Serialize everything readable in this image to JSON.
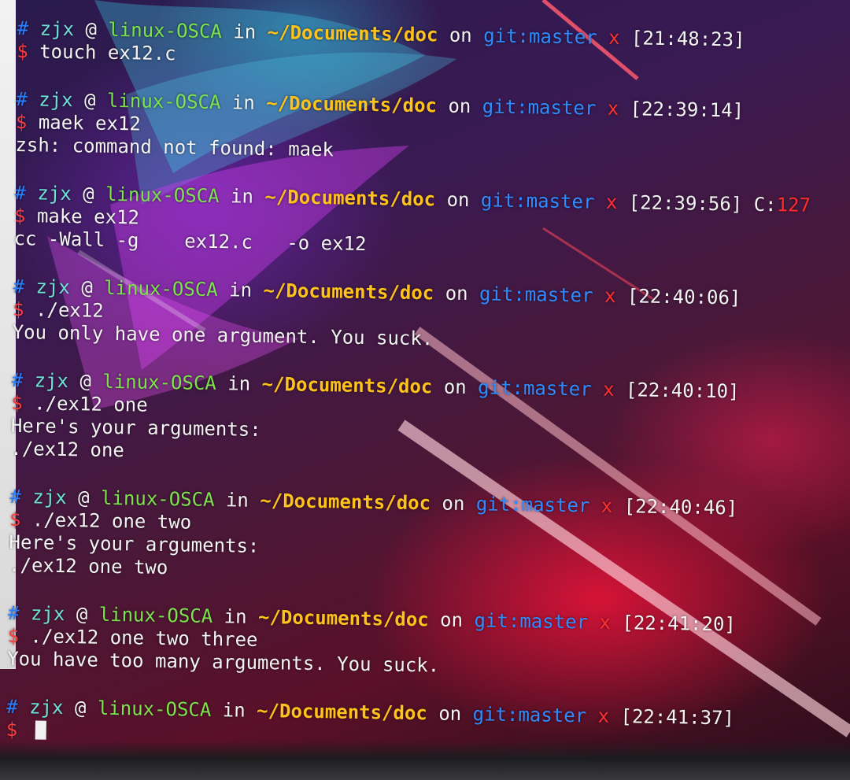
{
  "colors": {
    "hash": "#2a7fff",
    "dollar": "#ff3b3b",
    "user": "#6fe0d6",
    "host": "#7ce34c",
    "path": "#ffc21a",
    "git": "#2f8cff",
    "mark": "#ff3030",
    "exit_code": "#ff2a2a"
  },
  "prompt": {
    "hash_symbol": "#",
    "dollar_symbol": "$",
    "user": "zjx",
    "at": "@",
    "host": "linux-OSCA",
    "in_word": "in",
    "path": "~/Documents/doc",
    "on_word": "on",
    "git_label": "git:",
    "branch": "master",
    "dirty_mark": "x"
  },
  "blocks": [
    {
      "time": "[21:48:23]",
      "command": "touch ex12.c",
      "output": []
    },
    {
      "time": "[22:39:14]",
      "command": "maek ex12",
      "output": [
        "zsh: command not found: maek"
      ]
    },
    {
      "time": "[22:39:56]",
      "exit_label": "C:",
      "exit_code": "127",
      "command": "make ex12",
      "output": [
        "cc -Wall -g    ex12.c   -o ex12"
      ]
    },
    {
      "time": "[22:40:06]",
      "command": "./ex12",
      "output": [
        "You only have one argument. You suck."
      ]
    },
    {
      "time": "[22:40:10]",
      "command": "./ex12 one",
      "output": [
        "Here's your arguments:",
        "./ex12 one"
      ]
    },
    {
      "time": "[22:40:46]",
      "command": "./ex12 one two",
      "output": [
        "Here's your arguments:",
        "./ex12 one two"
      ]
    },
    {
      "time": "[22:41:20]",
      "command": "./ex12 one two three",
      "output": [
        "You have too many arguments. You suck."
      ]
    },
    {
      "time": "[22:41:37]",
      "command": "",
      "output": [],
      "active": true
    }
  ]
}
